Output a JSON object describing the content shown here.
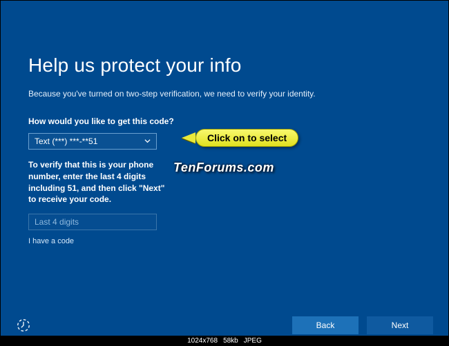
{
  "heading": "Help us protect your info",
  "subtext": "Because you've turned on two-step verification, we need to verify your identity.",
  "form": {
    "prompt": "How would you like to get this code?",
    "selected_option": "Text (***) ***-**51",
    "verify_explain": "To verify that this is your phone number, enter the last 4 digits including 51, and then click \"Next\" to receive your code.",
    "digits_placeholder": "Last 4 digits",
    "have_code": "I have a code"
  },
  "buttons": {
    "back": "Back",
    "next": "Next"
  },
  "annotation": {
    "callout": "Click on to select",
    "watermark": "TenForums.com"
  },
  "footer": {
    "dimensions": "1024x768",
    "size": "58kb",
    "format": "JPEG"
  }
}
